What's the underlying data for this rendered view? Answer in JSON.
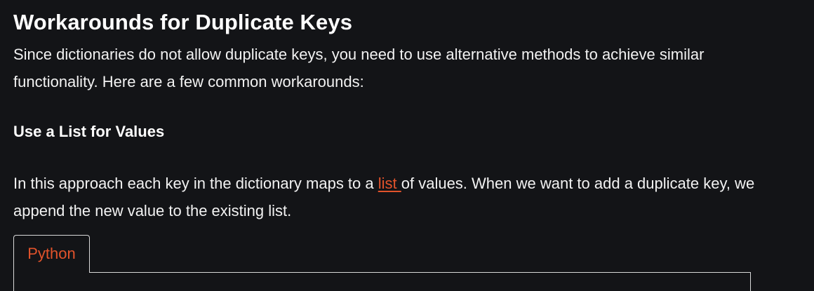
{
  "heading": "Workarounds for Duplicate Keys",
  "intro": "Since dictionaries do not allow duplicate keys, you need to use alternative methods to achieve similar functionality. Here are a few common workarounds:",
  "subheading": "Use a List for Values",
  "approach": {
    "before": "In this approach each key in the dictionary maps to a ",
    "link": "list ",
    "after": "of values. When we want to add a duplicate key, we append the new value to the existing list."
  },
  "code_tabs": [
    {
      "label": "Python"
    }
  ],
  "colors": {
    "background": "#131417",
    "text": "#ffffff",
    "accent": "#e2532b",
    "border": "#d9d9d9"
  }
}
